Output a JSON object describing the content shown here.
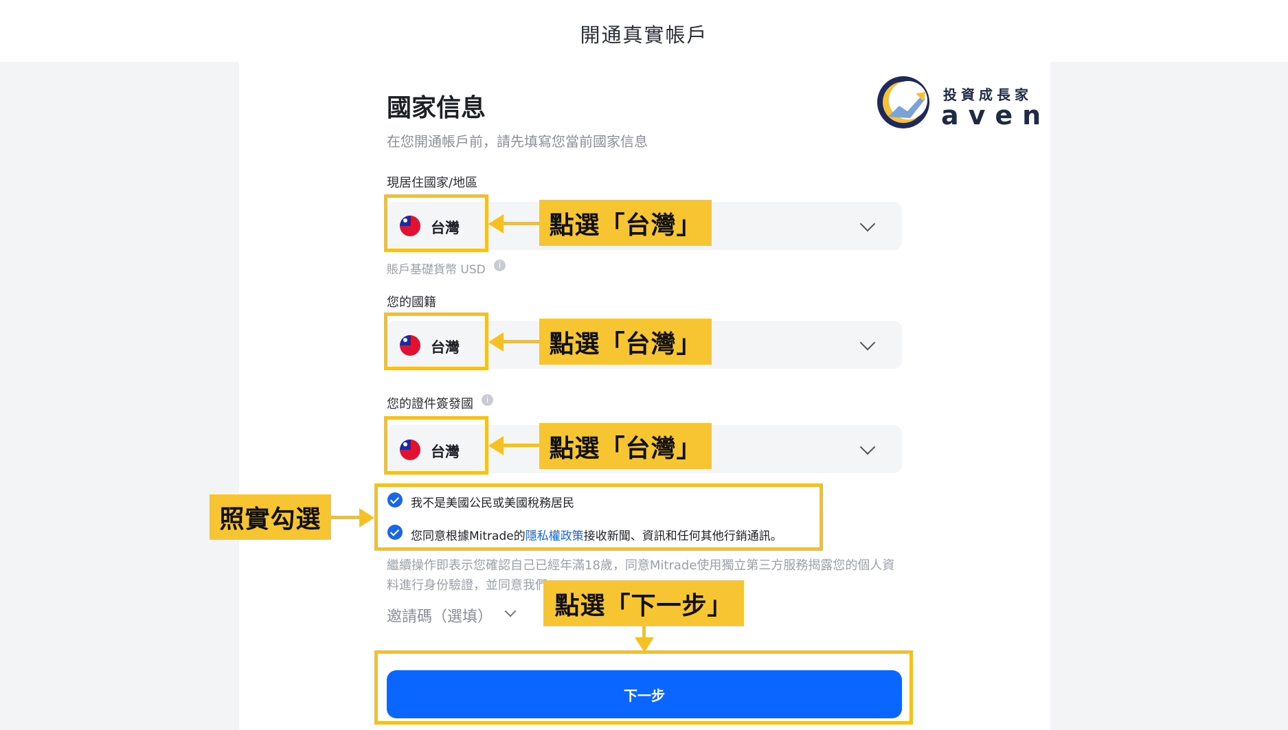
{
  "header": {
    "title": "開通真實帳戶"
  },
  "section": {
    "title": "國家信息",
    "subtitle": "在您開通帳戶前，請先填寫您當前國家信息"
  },
  "logo": {
    "tagline": "投資成長家",
    "wordmark": "aven"
  },
  "residence": {
    "label": "現居住國家/地區",
    "value": "台灣",
    "hint": "賬戶基礎貨幣 USD"
  },
  "nationality": {
    "label": "您的國籍",
    "value": "台灣"
  },
  "id_issuer": {
    "label": "您的證件簽發國",
    "value": "台灣"
  },
  "checks": {
    "not_us": "我不是美國公民或美國稅務居民",
    "consent_prefix": "您同意根據Mitrade的",
    "consent_link": "隱私權政策",
    "consent_suffix": "接收新聞、資訊和任何其他行銷通訊。"
  },
  "disclaimer": {
    "line1": "繼續操作即表示您確認自己已經年滿18歲，同意Mitrade使用獨立第三方服務揭露您的個人資",
    "line2": "料進行身份驗證，並同意我們"
  },
  "invite": {
    "label": "邀請碼（選填）"
  },
  "next_button": "下一步",
  "annotations": {
    "select_tw": "點選「台灣」",
    "tick": "照實勾選",
    "next": "點選「下一步」"
  },
  "colors": {
    "accent_blue": "#0b66ff",
    "highlight_yellow": "#f5c022"
  }
}
